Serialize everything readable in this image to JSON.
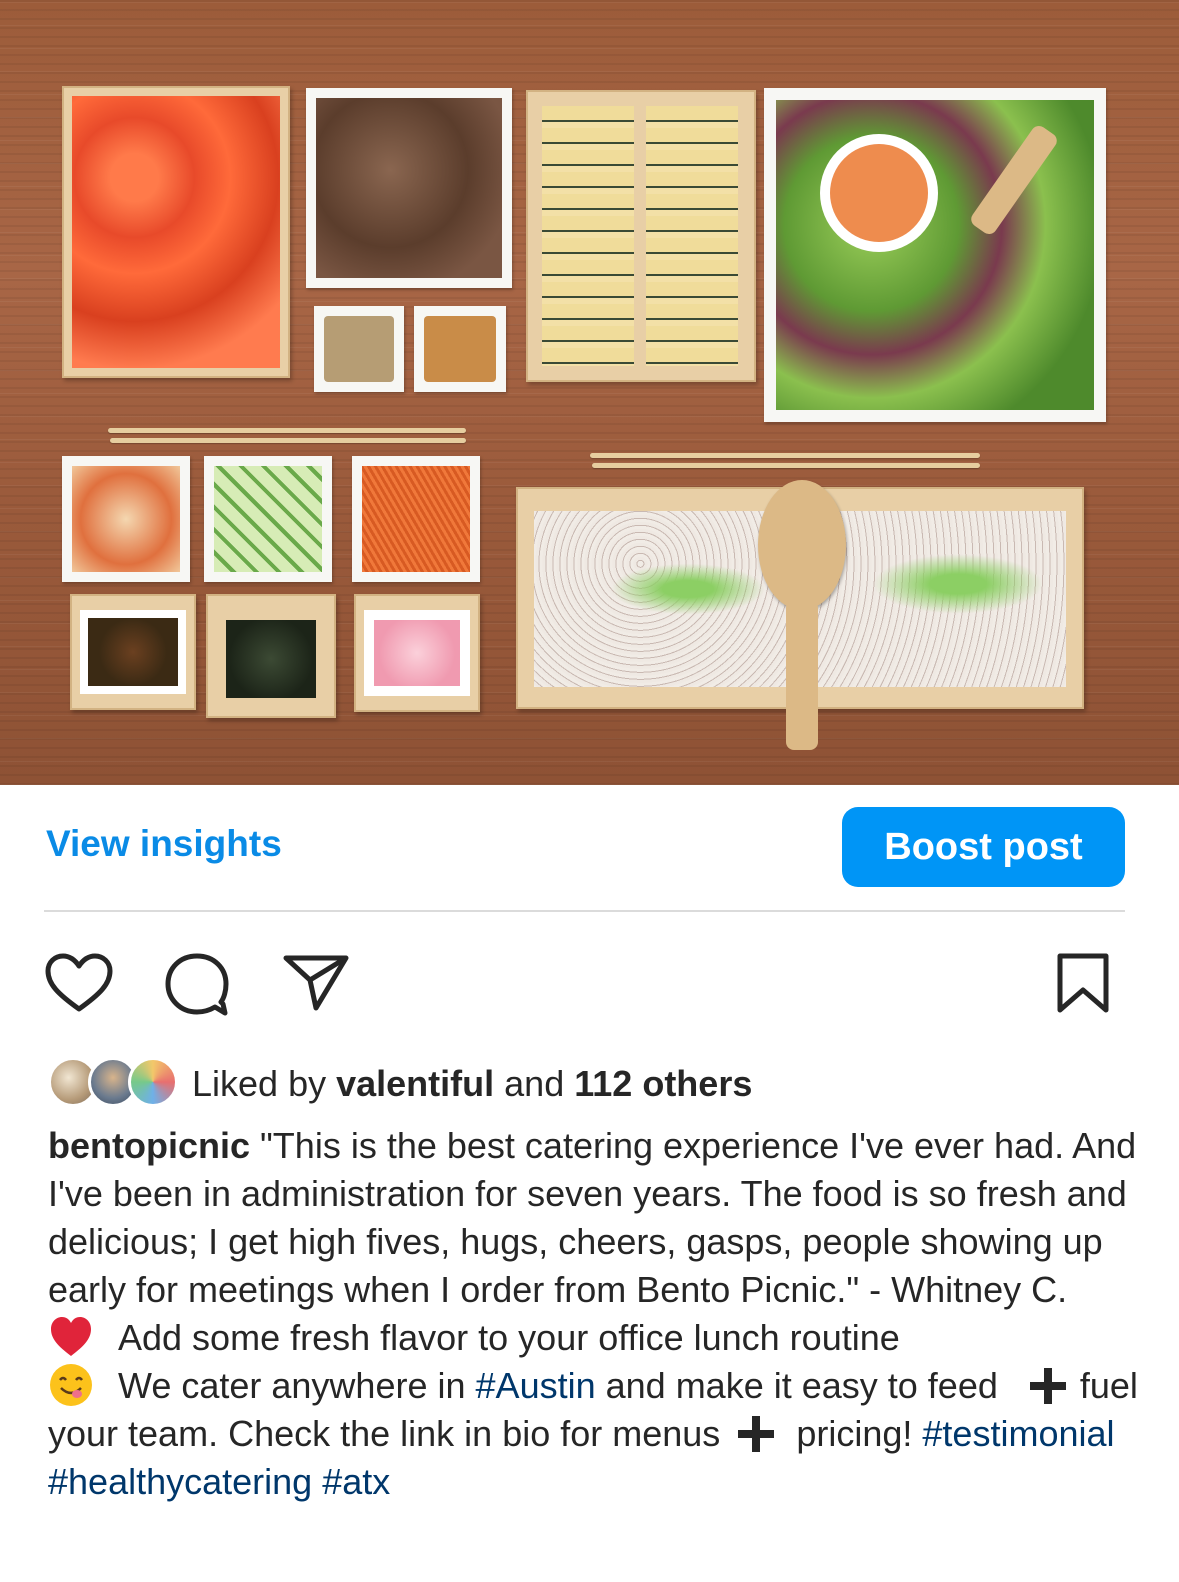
{
  "post": {
    "image_alt": "Bento Picnic catering spread: salmon, braised beef, rolled egg omelette, green salad with dressing, kimchi, cucumber, carrots, pickles, seaweed, pickled onions and rice in wooden boxes",
    "view_insights": "View insights",
    "boost_post": "Boost post"
  },
  "actions": {
    "like_icon": "heart-outline",
    "comment_icon": "speech-bubble",
    "share_icon": "paper-plane",
    "save_icon": "bookmark-outline"
  },
  "likes": {
    "prefix": "Liked by",
    "user": "valentiful",
    "connector": "and",
    "others": "112 others"
  },
  "caption": {
    "username": "bentopicnic",
    "quote": "\"This is the best catering experience I've ever had. And I've been in administration for seven years. The food is so fresh and delicious; I get high fives, hugs, cheers, gasps, people showing up early for meetings when I order from Bento Picnic.\" - Whitney C.",
    "line1": "Add some fresh flavor to your office lunch routine",
    "line2_a": "We cater anywhere in",
    "hashtag_austin": "#Austin",
    "line2_b": "and make it easy to feed",
    "line2_c": "fuel your team. Check the link in bio for menus",
    "line2_d": "pricing!",
    "hashtag_1": "#testimonial",
    "hashtag_2": "#healthycatering",
    "hashtag_3": "#atx"
  },
  "colors": {
    "primary_blue": "#0095f6",
    "link_blue": "#0a8be6",
    "hashtag": "#00376b",
    "text": "#262626"
  }
}
